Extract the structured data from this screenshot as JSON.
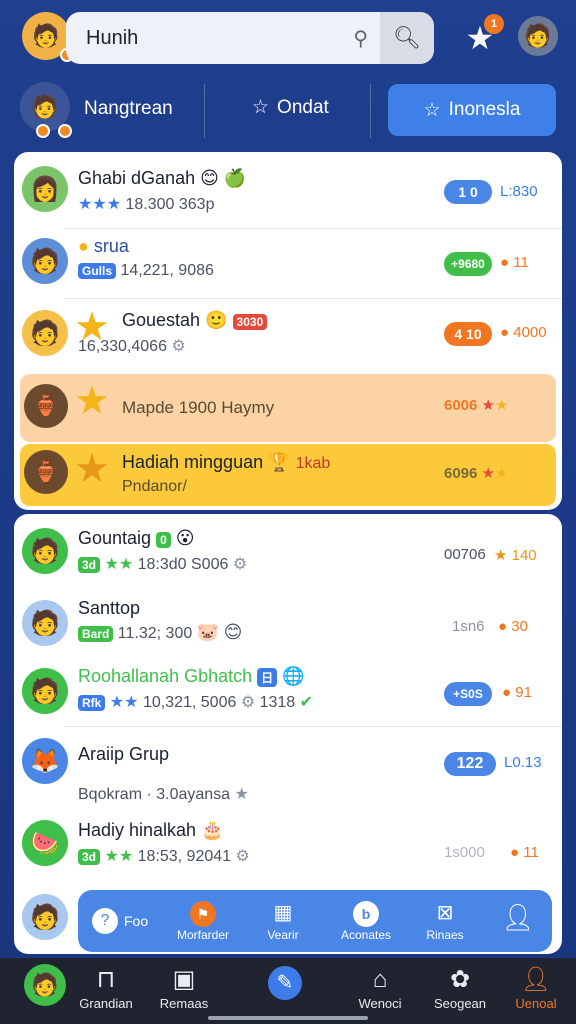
{
  "topbar": {
    "search_value": "Hunih",
    "notif_count": "1"
  },
  "tabs": {
    "profile_label": "Nangtrean",
    "mid_label": "Ondat",
    "active_label": "Inonesla"
  },
  "card1": {
    "rows": [
      {
        "title": "Ghabi dGanah",
        "sub": "18.300 363p",
        "pill": "1 0",
        "val": "L:830"
      },
      {
        "title": "srua",
        "tag": "Gulls",
        "sub": "14,221, 9086",
        "pill": "+9680",
        "val": "11"
      },
      {
        "title": "Gouestah",
        "tag": "3030",
        "sub": "16,330,4066",
        "pill": "4 10",
        "val": "4000"
      }
    ],
    "highlight1": {
      "text": "Mapde 1900 Haymy",
      "val": "6006"
    },
    "highlight2": {
      "title": "Hadiah mingguan",
      "badge": "1kab",
      "sub": "Pndanor/",
      "val": "6096"
    }
  },
  "card2": {
    "rows": [
      {
        "title": "Gountaig",
        "tag": "0",
        "sub_tag": "3d",
        "sub": "18:3d0 S006",
        "val": "00706",
        "val2": "140"
      },
      {
        "title": "Santtop",
        "sub_tag": "Bard",
        "sub": "11.32; 300",
        "val": "1sn6",
        "val2": "30"
      },
      {
        "title": "Roohallanah Gbhatch",
        "tag": "日",
        "sub_tag": "Rfk",
        "sub": "10,321, 5006",
        "sub2": "1318",
        "pill": "+S0S",
        "val2": "91"
      },
      {
        "title": "Araiip Grup",
        "sub": "Bqokram · 3.0ayansa",
        "pill": "122",
        "val": "L0.13"
      },
      {
        "title": "Hadiy hinalkah",
        "sub_tag": "3d",
        "sub": "18:53, 92041",
        "val": "1s000",
        "val2": "11"
      }
    ]
  },
  "fab": {
    "items": [
      {
        "label": "Foo",
        "icon": "chat-icon"
      },
      {
        "label": "Morfarder",
        "icon": "flag-icon"
      },
      {
        "label": "Vearir",
        "icon": "grid-icon"
      },
      {
        "label": "Aconates",
        "icon": "info-icon"
      },
      {
        "label": "Rinaes",
        "icon": "image-icon"
      },
      {
        "label": "",
        "icon": "user-icon"
      }
    ]
  },
  "nav": {
    "items": [
      {
        "label": "Grandian"
      },
      {
        "label": "Remaas"
      },
      {
        "label": "Wenoci"
      },
      {
        "label": "Seogean"
      },
      {
        "label": "Uenoal"
      }
    ]
  },
  "colors": {
    "accent": "#3f80e8",
    "orange": "#f07622",
    "green": "#3fbf4a",
    "highlight_peach": "#fbd3a4",
    "highlight_gold": "#fbc93a"
  }
}
